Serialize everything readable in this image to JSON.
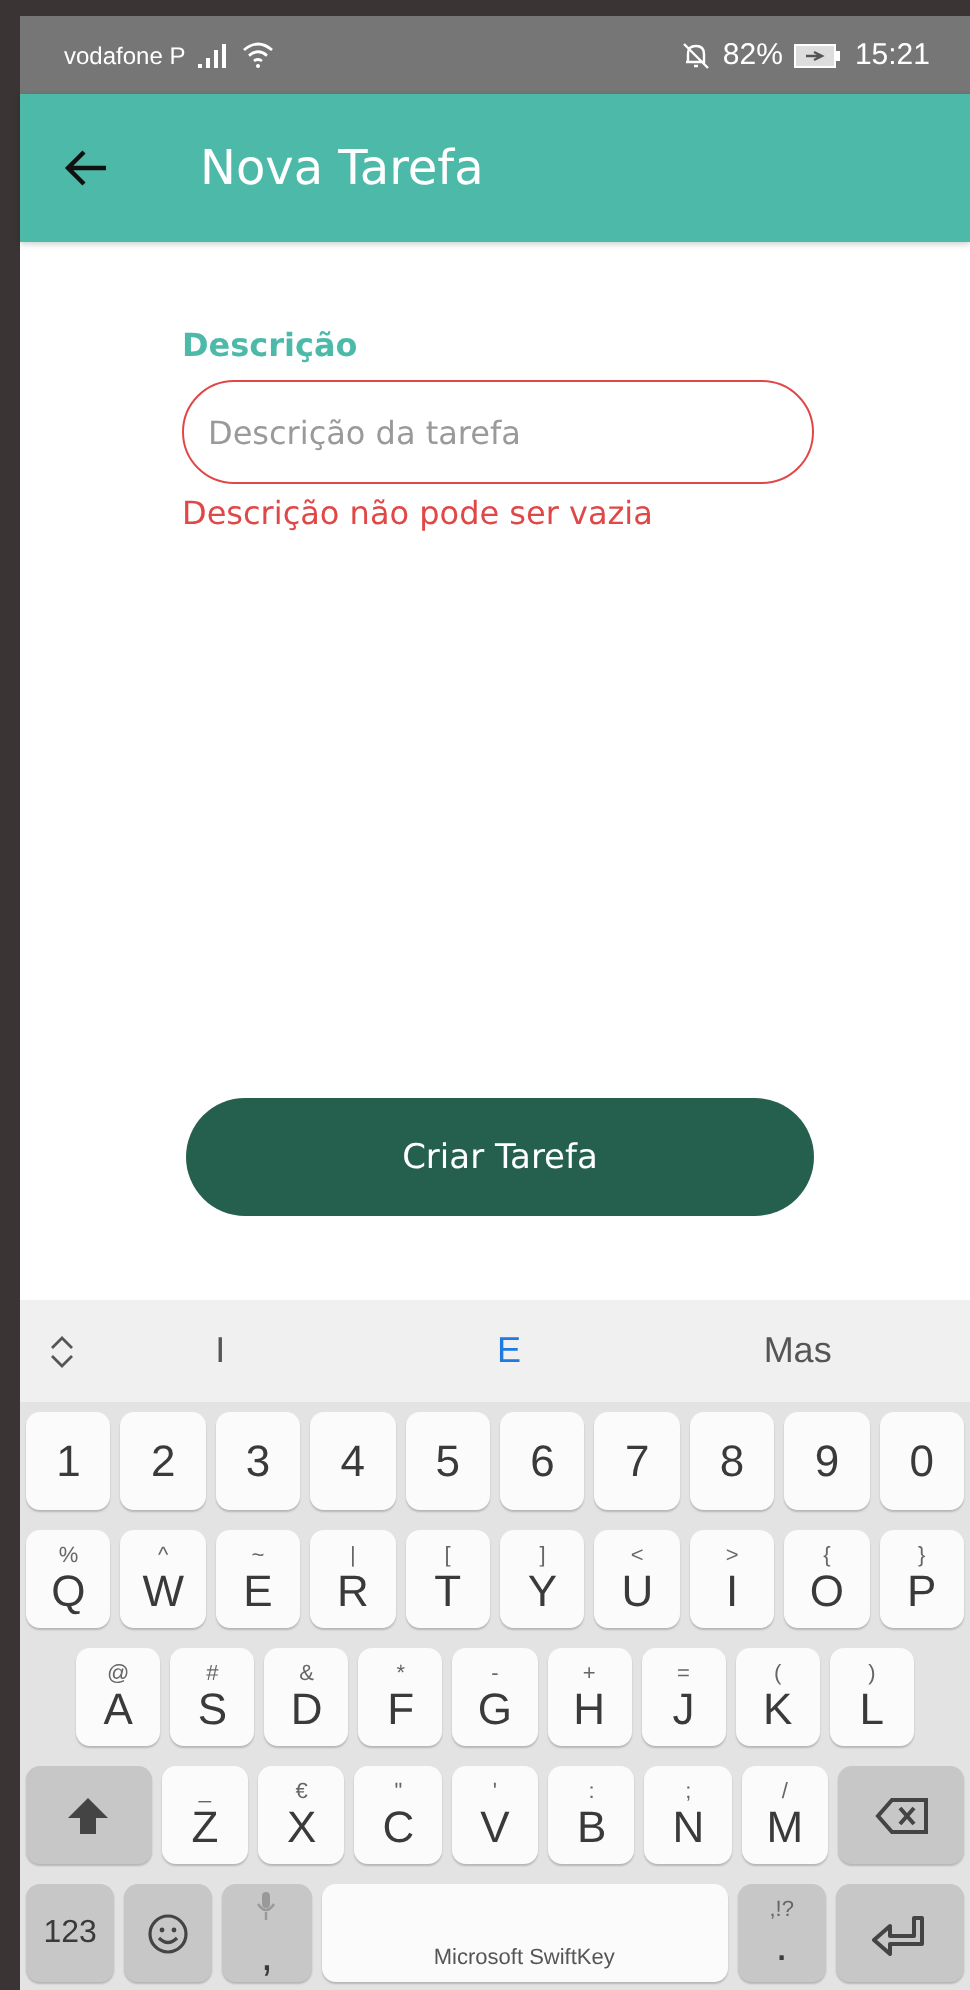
{
  "status_bar": {
    "carrier": "vodafone P",
    "battery": "82%",
    "time": "15:21"
  },
  "app_bar": {
    "title": "Nova Tarefa"
  },
  "form": {
    "label": "Descrição",
    "field": {
      "placeholder": "Descrição da tarefa",
      "invalid": true
    },
    "error": "Descrição não pode ser vazia"
  },
  "button": "Criar Tarefa",
  "keyboard": {
    "suggestions": [
      {
        "text": "I",
        "selected": false
      },
      {
        "text": "E",
        "selected": true
      },
      {
        "text": "Mas",
        "selected": false
      }
    ],
    "rows": [
      {
        "keys": [
          {
            "kind": "char",
            "label": "1"
          },
          {
            "kind": "char",
            "label": "2"
          },
          {
            "kind": "char",
            "label": "3"
          },
          {
            "kind": "char",
            "label": "4"
          },
          {
            "kind": "char",
            "label": "5"
          },
          {
            "kind": "char",
            "label": "6"
          },
          {
            "kind": "char",
            "label": "7"
          },
          {
            "kind": "char",
            "label": "8"
          },
          {
            "kind": "char",
            "label": "9"
          },
          {
            "kind": "char",
            "label": "0"
          }
        ]
      },
      {
        "keys": [
          {
            "kind": "char",
            "label": "Q",
            "hint": "%"
          },
          {
            "kind": "char",
            "label": "W",
            "hint": "^"
          },
          {
            "kind": "char",
            "label": "E",
            "hint": "~"
          },
          {
            "kind": "char",
            "label": "R",
            "hint": "|"
          },
          {
            "kind": "char",
            "label": "T",
            "hint": "["
          },
          {
            "kind": "char",
            "label": "Y",
            "hint": "]"
          },
          {
            "kind": "char",
            "label": "U",
            "hint": "<"
          },
          {
            "kind": "char",
            "label": "I",
            "hint": ">"
          },
          {
            "kind": "char",
            "label": "O",
            "hint": "{"
          },
          {
            "kind": "char",
            "label": "P",
            "hint": "}"
          }
        ]
      },
      {
        "keys": [
          {
            "kind": "char",
            "label": "A",
            "hint": "@"
          },
          {
            "kind": "char",
            "label": "S",
            "hint": "#"
          },
          {
            "kind": "char",
            "label": "D",
            "hint": "&"
          },
          {
            "kind": "char",
            "label": "F",
            "hint": "*"
          },
          {
            "kind": "char",
            "label": "G",
            "hint": "-"
          },
          {
            "kind": "char",
            "label": "H",
            "hint": "+"
          },
          {
            "kind": "char",
            "label": "J",
            "hint": "="
          },
          {
            "kind": "char",
            "label": "K",
            "hint": "("
          },
          {
            "kind": "char",
            "label": "L",
            "hint": ")"
          }
        ]
      },
      {
        "keys": [
          {
            "kind": "shift"
          },
          {
            "kind": "char",
            "label": "Z",
            "hint": "_"
          },
          {
            "kind": "char",
            "label": "X",
            "hint": "€"
          },
          {
            "kind": "char",
            "label": "C",
            "hint": "\""
          },
          {
            "kind": "char",
            "label": "V",
            "hint": "'"
          },
          {
            "kind": "char",
            "label": "B",
            "hint": ":"
          },
          {
            "kind": "char",
            "label": "N",
            "hint": ";"
          },
          {
            "kind": "char",
            "label": "M",
            "hint": "/"
          },
          {
            "kind": "backspace"
          }
        ]
      },
      {
        "keys": [
          {
            "kind": "symbols",
            "label": "123"
          },
          {
            "kind": "emoji"
          },
          {
            "kind": "voice",
            "label": ","
          },
          {
            "kind": "space",
            "label": "Microsoft SwiftKey"
          },
          {
            "kind": "punct",
            "label": ".",
            "hint": ",!?"
          },
          {
            "kind": "enter"
          }
        ]
      }
    ]
  }
}
